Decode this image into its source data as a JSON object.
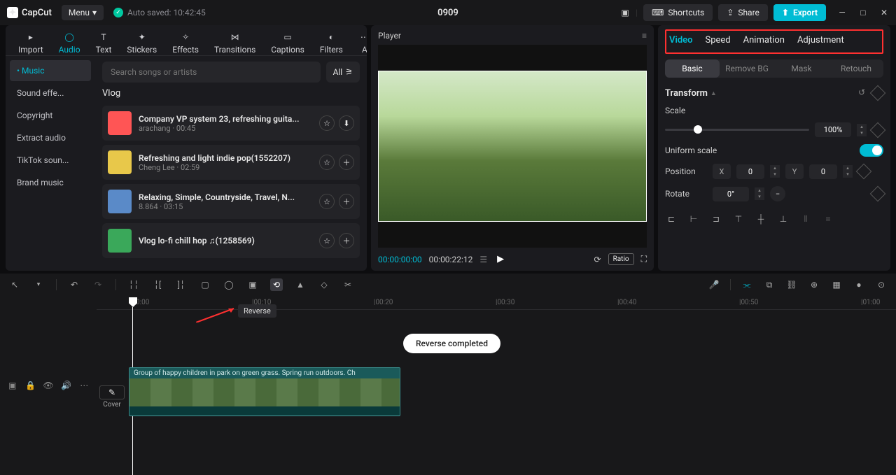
{
  "titlebar": {
    "logo": "CapCut",
    "menu": "Menu",
    "autosave": "Auto saved: 10:42:45",
    "project": "0909",
    "shortcuts": "Shortcuts",
    "share": "Share",
    "export": "Export"
  },
  "topTabs": [
    {
      "label": "Import",
      "icon": "import"
    },
    {
      "label": "Audio",
      "icon": "audio",
      "active": true
    },
    {
      "label": "Text",
      "icon": "text"
    },
    {
      "label": "Stickers",
      "icon": "stickers"
    },
    {
      "label": "Effects",
      "icon": "effects"
    },
    {
      "label": "Transitions",
      "icon": "transitions"
    },
    {
      "label": "Captions",
      "icon": "captions"
    },
    {
      "label": "Filters",
      "icon": "filters"
    },
    {
      "label": "A",
      "icon": "more"
    }
  ],
  "sideTabs": {
    "items": [
      "Music",
      "Sound effe...",
      "Copyright",
      "Extract audio",
      "TikTok soun...",
      "Brand music"
    ],
    "activeIdx": 0,
    "dotPrefix": "•"
  },
  "search": {
    "placeholder": "Search songs or artists",
    "all": "All"
  },
  "songSection": "Vlog",
  "songs": [
    {
      "title": "Company VP system 23, refreshing guita...",
      "meta": "arachang · 00:45",
      "thumb": "#ff5555",
      "acts": [
        "fav",
        "dl"
      ]
    },
    {
      "title": "Refreshing and light indie pop(1552207)",
      "meta": "Cheng Lee · 02:59",
      "thumb": "#e8c84a",
      "acts": [
        "fav",
        "add"
      ]
    },
    {
      "title": "Relaxing, Simple, Countryside, Travel, N...",
      "meta": "8.864 · 03:15",
      "thumb": "#5a8ac8",
      "acts": [
        "fav",
        "add"
      ]
    },
    {
      "title": "Vlog  lo-fi chill hop ♫(1258569)",
      "meta": "",
      "thumb": "#3aa85a",
      "acts": [
        "fav",
        "add"
      ]
    }
  ],
  "player": {
    "label": "Player",
    "timeCur": "00:00:00:00",
    "timeDur": "00:00:22:12",
    "ratio": "Ratio"
  },
  "rightTabs": [
    "Video",
    "Speed",
    "Animation",
    "Adjustment"
  ],
  "rightSubTabs": [
    "Basic",
    "Remove BG",
    "Mask",
    "Retouch"
  ],
  "transform": {
    "title": "Transform",
    "scale": "Scale",
    "scaleVal": "100%",
    "uniform": "Uniform scale",
    "position": "Position",
    "x": "X",
    "xVal": "0",
    "y": "Y",
    "yVal": "0",
    "rotate": "Rotate",
    "rotVal": "0°"
  },
  "timeline": {
    "ticks": [
      "|00:00",
      "|00:10",
      "|00:20",
      "|00:30",
      "|00:40",
      "|00:50",
      "|01:00"
    ],
    "tooltip": "Reverse",
    "toast": "Reverse completed",
    "cover": "Cover",
    "clipLabel": "Group of happy children in park on green grass. Spring run outdoors. Ch"
  }
}
